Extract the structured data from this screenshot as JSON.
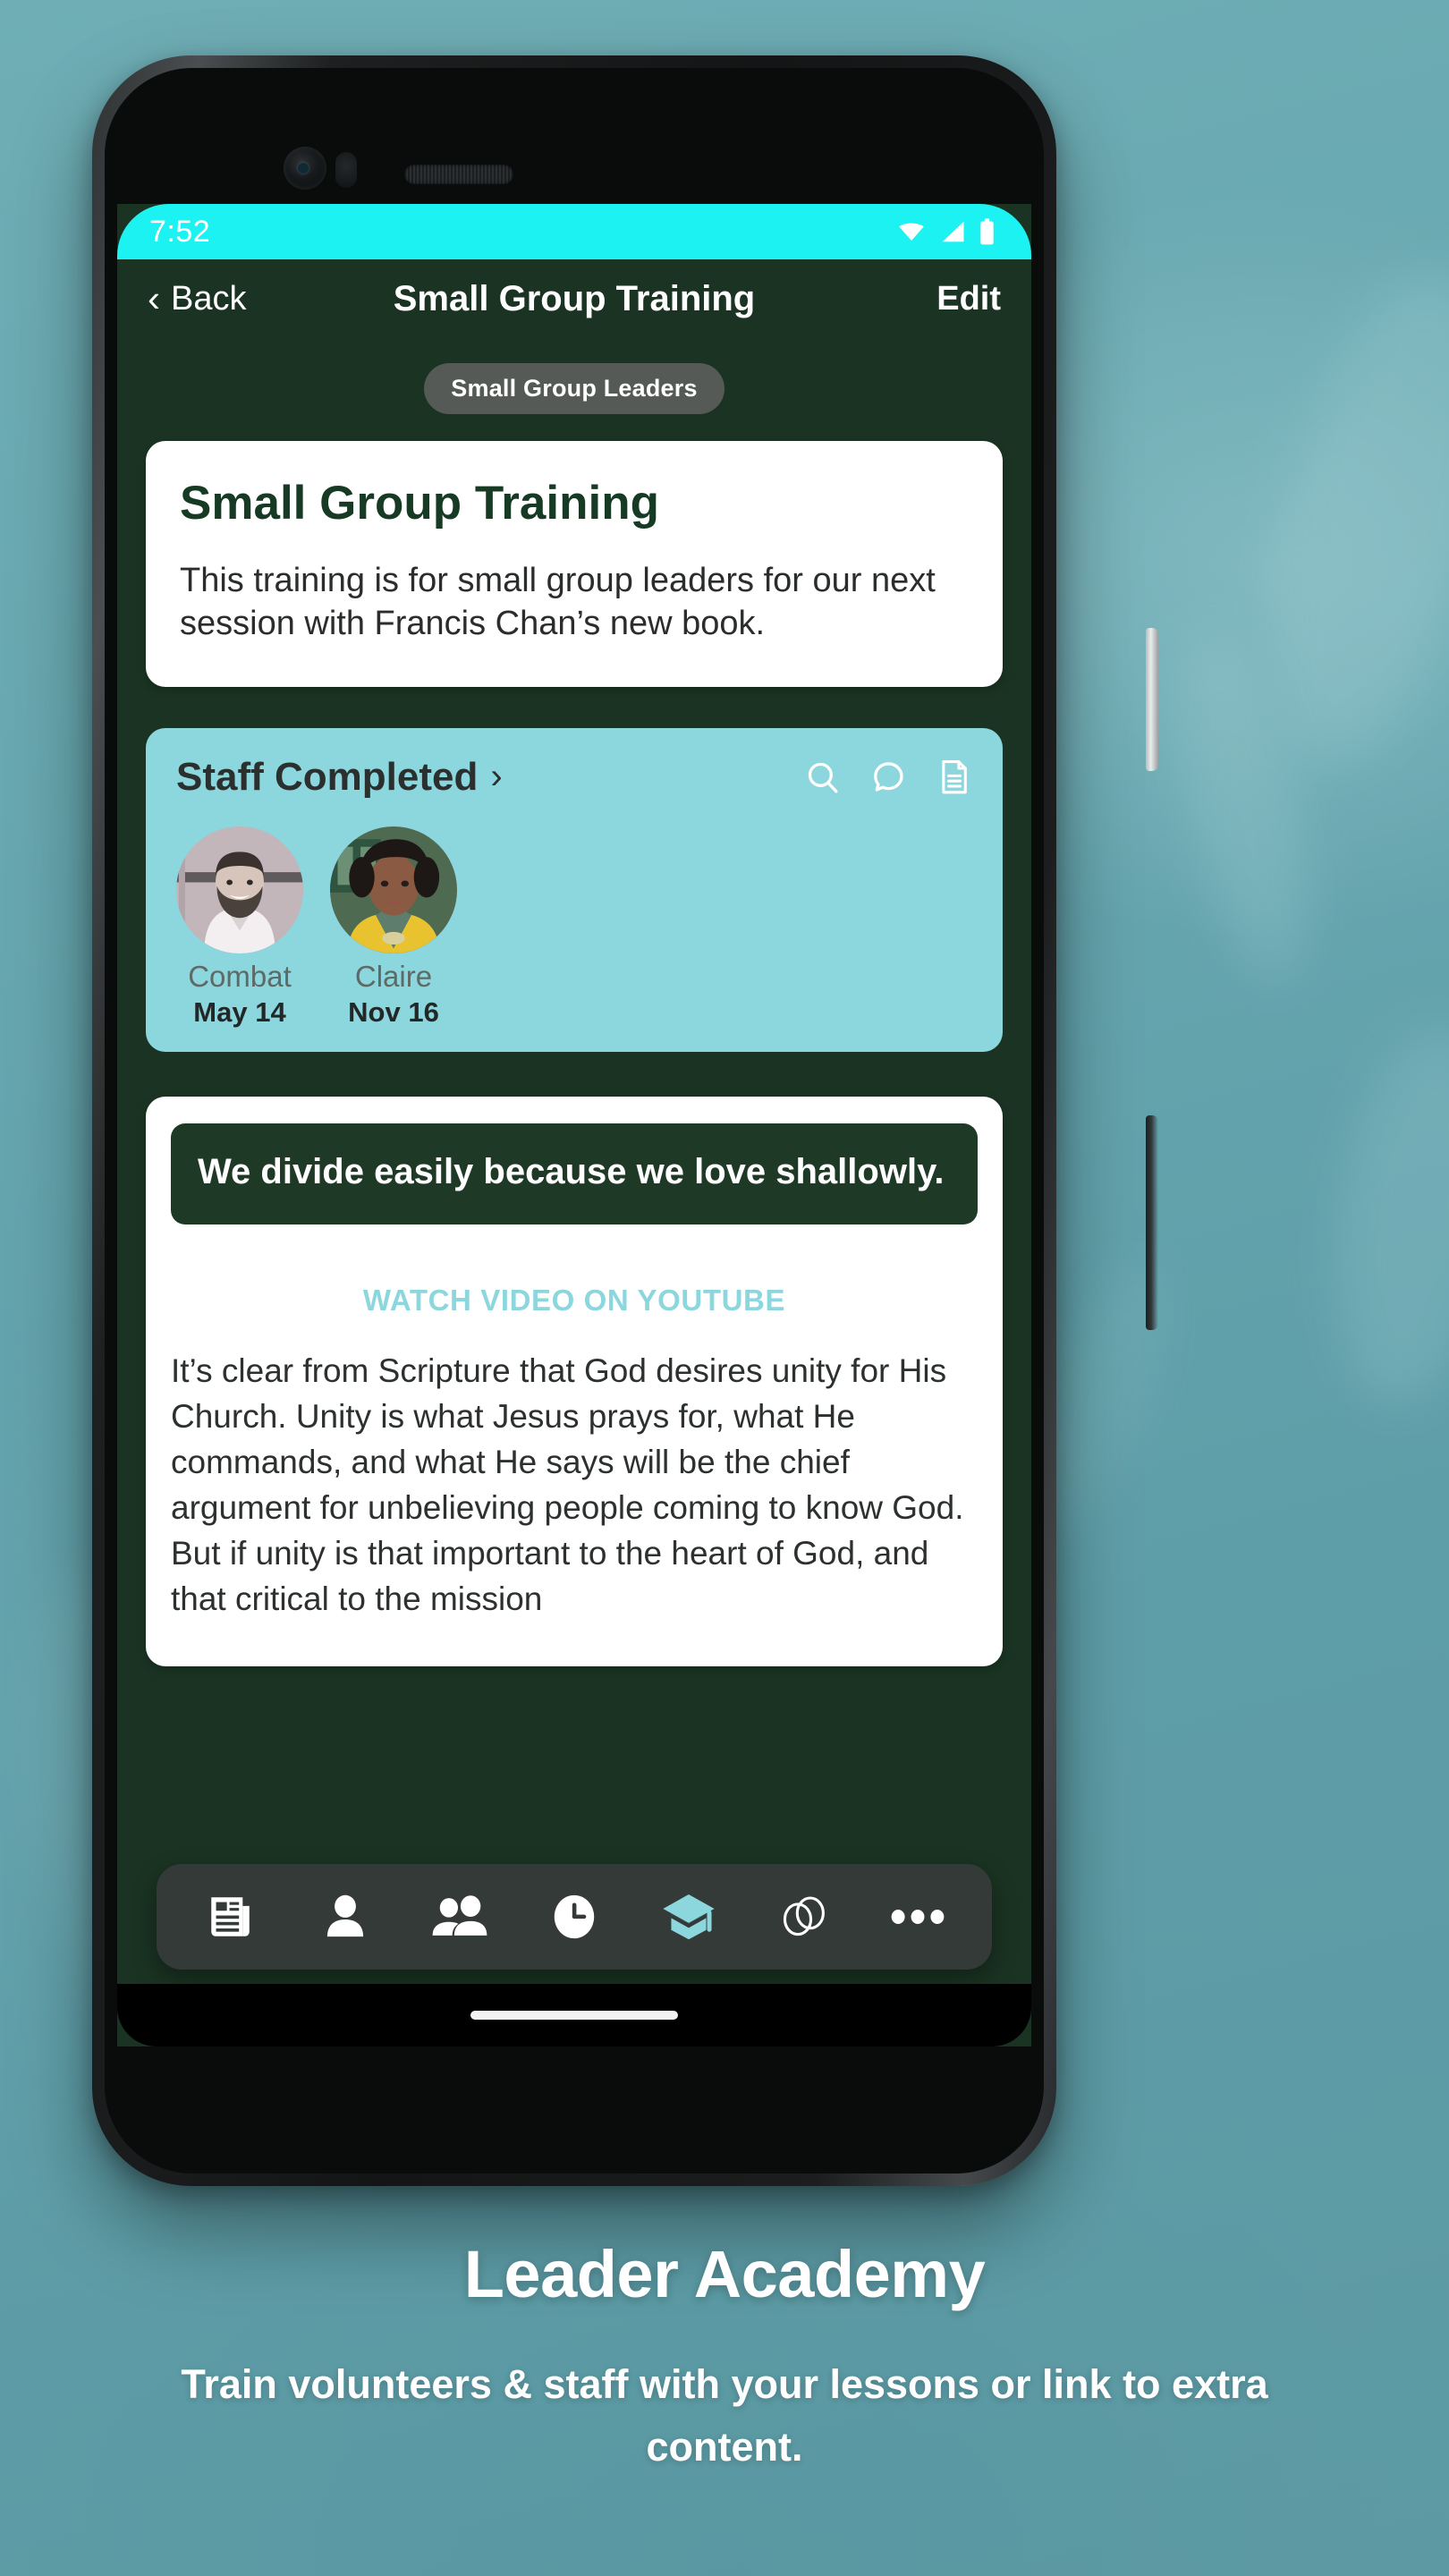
{
  "wallpaper": {
    "color": "#63A5AE"
  },
  "phone": {
    "hardware": {
      "camera_icon": "front-camera-icon",
      "sensor_icon": "proximity-sensor-icon",
      "speaker_icon": "earpiece-speaker-icon",
      "power_button": "power-button",
      "volume_button": "volume-rocker-button"
    }
  },
  "status_bar": {
    "time": "7:52",
    "background": "#1DF2F2",
    "icons": [
      "wifi-icon",
      "cell-signal-icon",
      "battery-icon"
    ]
  },
  "nav_bar": {
    "back_label": "Back",
    "back_icon": "chevron-left-icon",
    "title": "Small Group Training",
    "edit_label": "Edit"
  },
  "category_pill": {
    "label": "Small Group Leaders"
  },
  "overview_card": {
    "title": "Small Group Training",
    "description": "This training is for small group leaders for our next session with Francis Chan’s new book."
  },
  "staff_card": {
    "title": "Staff Completed",
    "chevron_icon": "chevron-right-icon",
    "background": "#8CD6DE",
    "actions": [
      "search-icon",
      "chat-bubble-icon",
      "document-icon"
    ],
    "people": [
      {
        "name": "Combat",
        "date": "May 14",
        "avatar": "avatar-combat"
      },
      {
        "name": "Claire",
        "date": "Nov 16",
        "avatar": "avatar-claire"
      }
    ]
  },
  "lesson_card": {
    "banner_quote": "We divide easily because we love shallowly.",
    "video_link_label": "WATCH VIDEO ON YOUTUBE",
    "link_color": "#8CD6DE",
    "body": "It’s clear from Scripture that God desires unity for His Church. Unity is what Jesus prays for, what He commands, and what He says will be the chief argument for unbelieving people coming to know God. But if unity is that important to the heart of God, and that critical to the mission"
  },
  "tab_bar": {
    "background": "#343a38",
    "active_color": "#8CD6DE",
    "items": [
      {
        "icon": "feed-news-icon",
        "active": false
      },
      {
        "icon": "person-icon",
        "active": false
      },
      {
        "icon": "people-group-icon",
        "active": false
      },
      {
        "icon": "clock-icon",
        "active": false
      },
      {
        "icon": "graduation-cap-icon",
        "active": true
      },
      {
        "icon": "overlapping-circles-icon",
        "active": false
      },
      {
        "icon": "more-ellipsis-icon",
        "active": false
      }
    ]
  },
  "home_indicator": {
    "label": "home-indicator"
  },
  "marketing": {
    "title": "Leader Academy",
    "subtitle": "Train volunteers & staff with your lessons or link to extra content."
  }
}
